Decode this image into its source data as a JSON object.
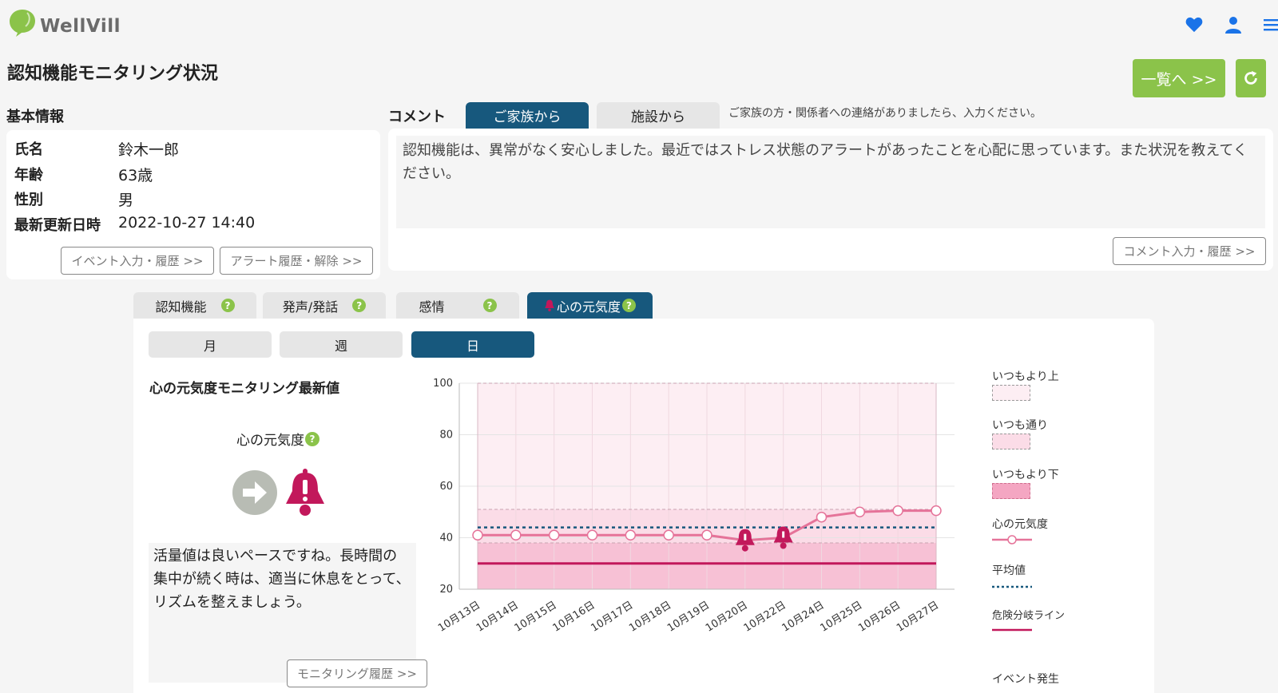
{
  "app": {
    "brand": "WellVill"
  },
  "page": {
    "title": "認知機能モニタリング状況"
  },
  "header_buttons": {
    "list": "一覧へ >>"
  },
  "basic_info": {
    "label": "基本情報",
    "rows": [
      {
        "key": "氏名",
        "value": "鈴木一郎"
      },
      {
        "key": "年齢",
        "value": "63歳"
      },
      {
        "key": "性別",
        "value": "男"
      },
      {
        "key": "最新更新日時",
        "value": "2022-10-27 14:40"
      }
    ],
    "event_button": "イベント入力・履歴 >>",
    "alert_button": "アラート履歴・解除 >>"
  },
  "comment": {
    "label": "コメント",
    "tabs": [
      "ご家族から",
      "施設から"
    ],
    "hint": "ご家族の方・関係者への連絡がありましたら、入力ください。",
    "text": "認知機能は、異常がなく安心しました。最近ではストレス状態のアラートがあったことを心配に思っています。また状況を教えてください。",
    "input_button": "コメント入力・履歴 >>"
  },
  "metric_tabs": [
    "認知機能",
    "発声/発話",
    "感情",
    "心の元気度"
  ],
  "period_tabs": [
    "月",
    "週",
    "日"
  ],
  "latest": {
    "title": "心の元気度モニタリング最新値",
    "metric": "心の元気度",
    "advice": "活量値は良いペースですね。長時間の集中が続く時は、適当に休息をとって、リズムを整えましょう。",
    "history_button": "モニタリング履歴 >>"
  },
  "legend": {
    "above": "いつもより上",
    "normal": "いつも通り",
    "below": "いつもより下",
    "series": "心の元気度",
    "average": "平均値",
    "danger": "危険分岐ライン",
    "event": "イベント発生"
  },
  "colors": {
    "accent_green": "#8bc34a",
    "tab_blue": "#17587d",
    "series_pink": "#e57399",
    "danger_red": "#c2185b",
    "band_above": "#fdeef3",
    "band_normal": "#fbdce7",
    "band_below": "#f7c1d5"
  },
  "chart_data": {
    "type": "line",
    "categories": [
      "10月13日",
      "10月14日",
      "10月15日",
      "10月16日",
      "10月17日",
      "10月18日",
      "10月19日",
      "10月20日",
      "10月22日",
      "10月24日",
      "10月25日",
      "10月26日",
      "10月27日"
    ],
    "series": [
      {
        "name": "心の元気度",
        "values": [
          41,
          41,
          41,
          41,
          41,
          41,
          41,
          39,
          40,
          48,
          50,
          50.5,
          50.5
        ]
      }
    ],
    "alerts": [
      "10月20日",
      "10月22日"
    ],
    "average": 44,
    "danger_line": 30,
    "bands": {
      "below_top": 38,
      "normal_top": 51,
      "above_top": 100
    },
    "yticks": [
      20,
      40,
      60,
      80,
      100
    ],
    "ylim": [
      20,
      100
    ]
  }
}
